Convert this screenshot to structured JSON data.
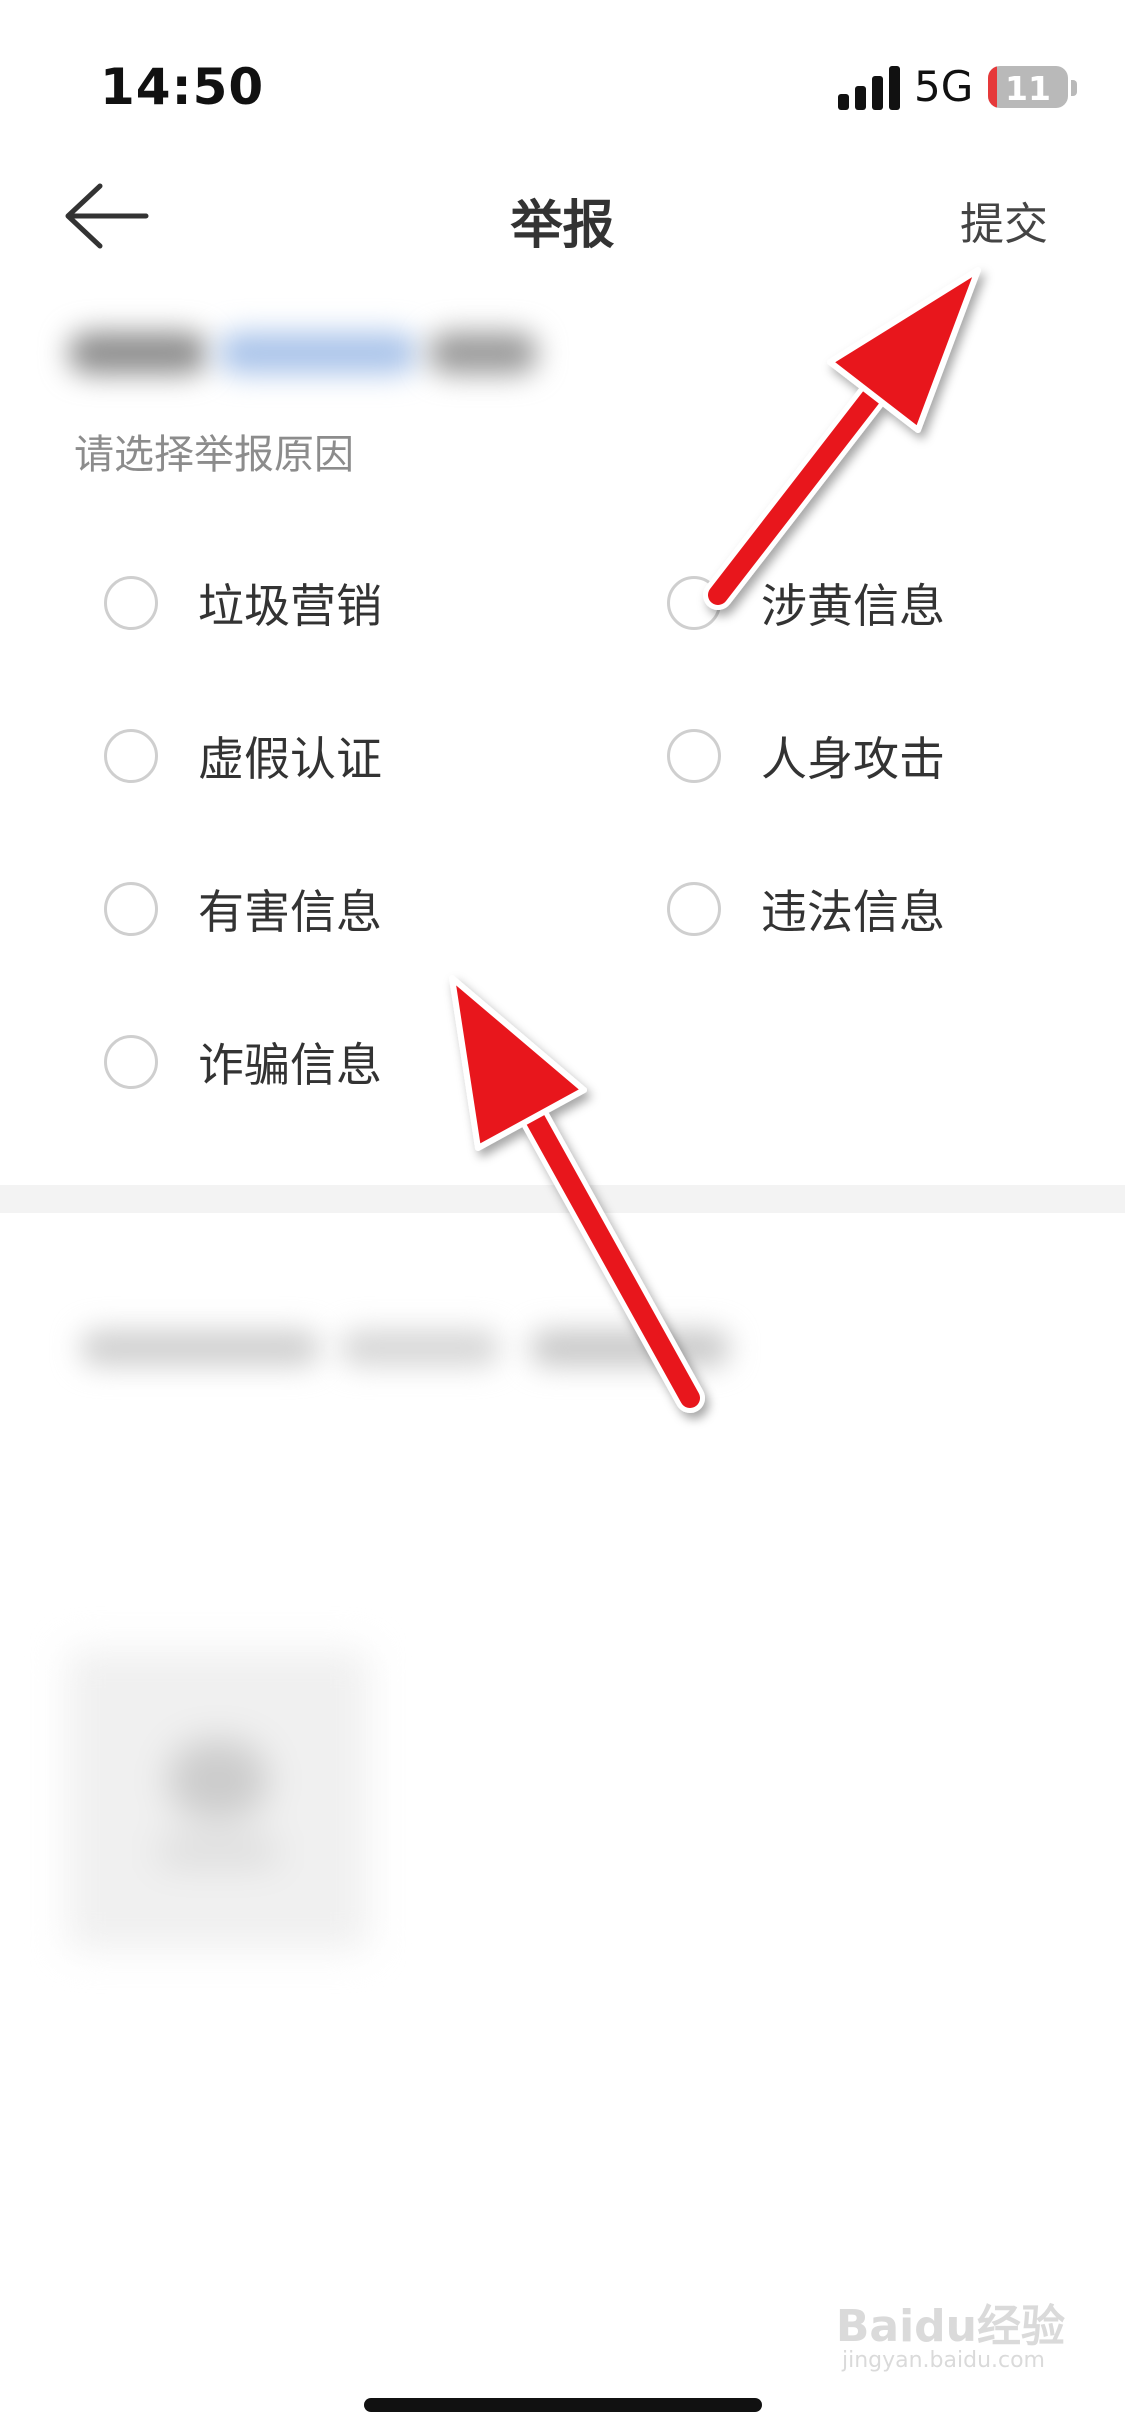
{
  "status_bar": {
    "time": "14:50",
    "network": "5G",
    "battery_level": "11",
    "battery_fraction": 0.11
  },
  "nav": {
    "back_icon": "arrow-left-icon",
    "title": "举报",
    "submit_label": "提交"
  },
  "form": {
    "prompt": "请选择举报原因",
    "options": [
      "垃圾营销",
      "涉黄信息",
      "虚假认证",
      "人身攻击",
      "有害信息",
      "违法信息",
      "诈骗信息"
    ]
  },
  "watermark": {
    "text": "Baidu经验",
    "sub": "jingyan.baidu.com"
  },
  "colors": {
    "annotation_arrow": "#e8141c",
    "battery_low": "#e6393a",
    "divider": "#f3f3f3"
  }
}
